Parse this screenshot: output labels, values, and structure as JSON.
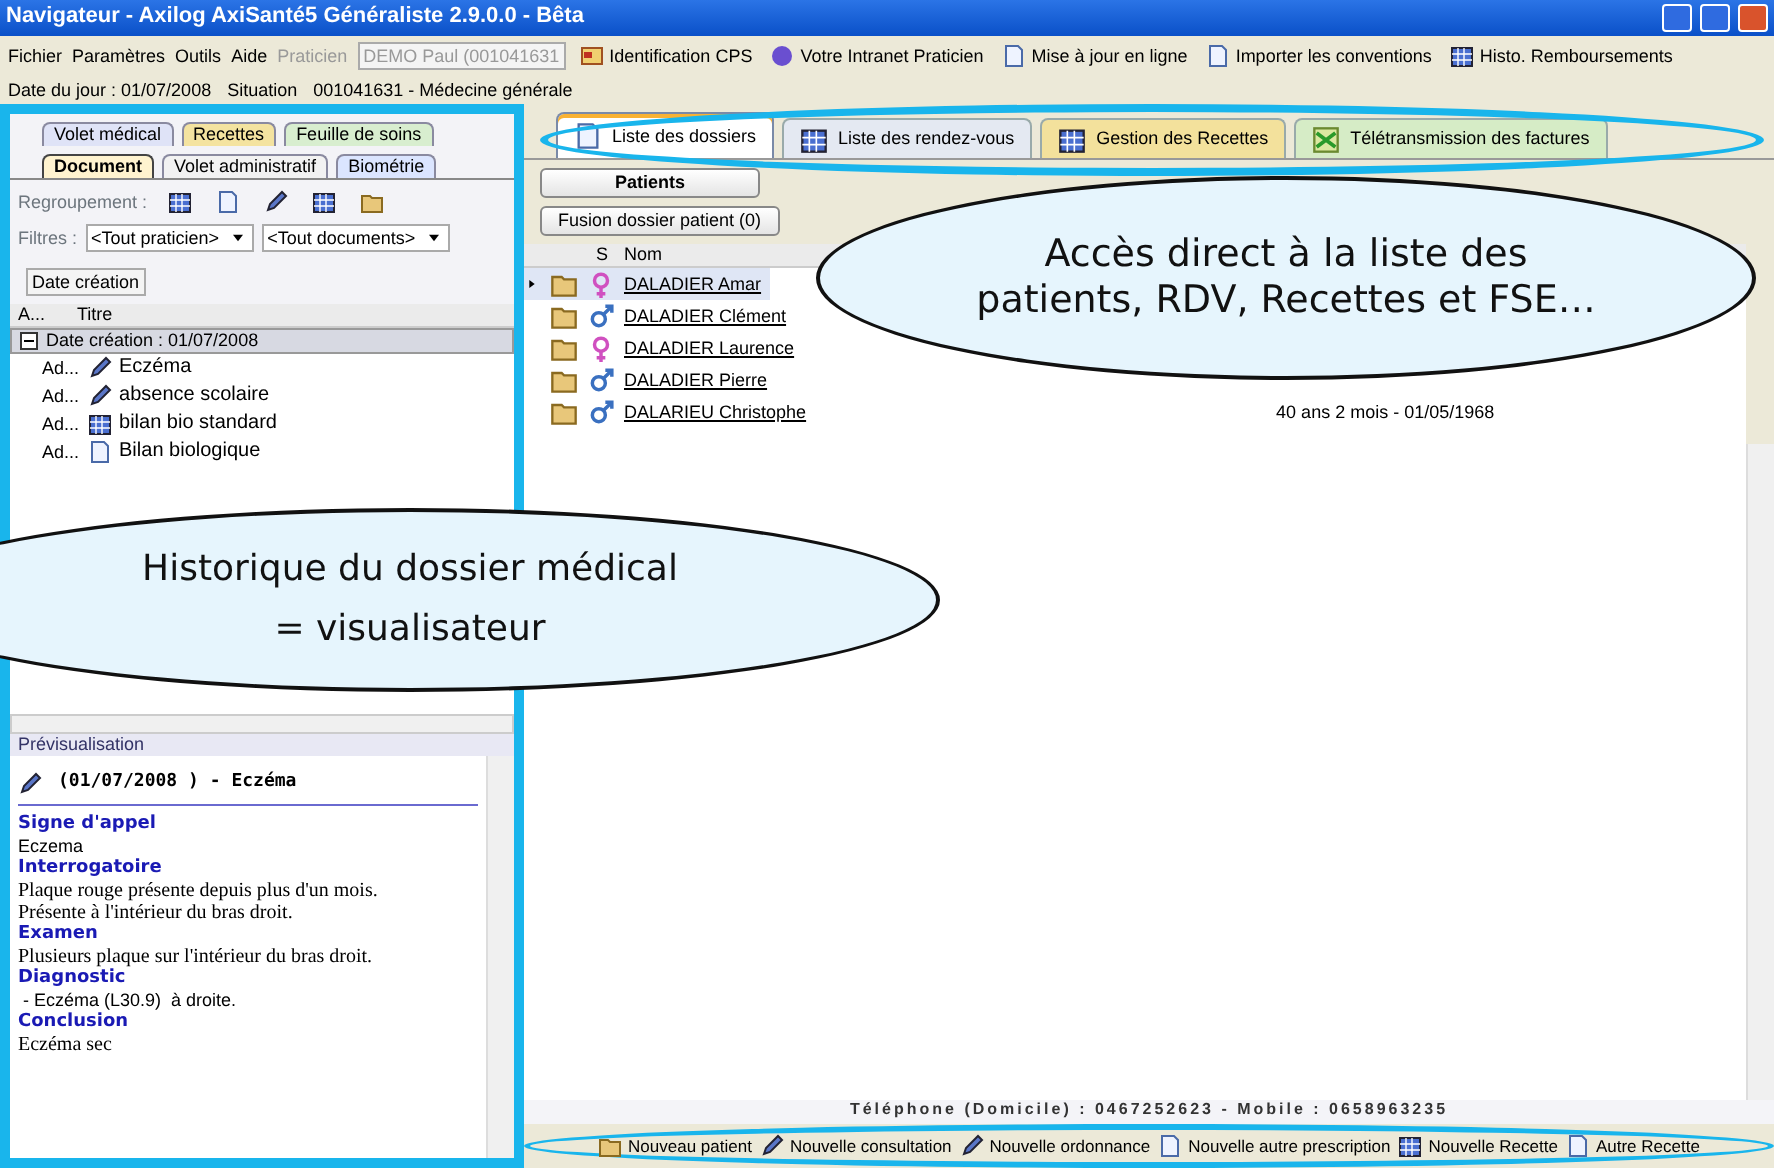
{
  "window": {
    "title": "Navigateur - Axilog AxiSanté5 Généraliste 2.9.0.0  - Bêta"
  },
  "menu": [
    "Fichier",
    "Paramètres",
    "Outils",
    "Aide"
  ],
  "praticien": {
    "label": "Praticien",
    "value": "DEMO Paul (001041631",
    "disabled": true
  },
  "toolbar": [
    "Identification CPS",
    "Votre Intranet Praticien",
    "Mise à jour en ligne",
    "Importer les conventions",
    "Histo. Remboursements"
  ],
  "info": {
    "date": "Date du jour : 01/07/2008",
    "situation_label": "Situation",
    "situation_value": "001041631 - Médecine générale"
  },
  "left_panel": {
    "tabs_row1": [
      {
        "label": "Volet médical",
        "selected": false,
        "color": "#dfe3f7"
      },
      {
        "label": "Recettes",
        "selected": false,
        "color": "#f4e3a0"
      },
      {
        "label": "Feuille de soins",
        "selected": false,
        "color": "#d8eecf"
      }
    ],
    "tabs_row2": [
      {
        "label": "Document",
        "selected": true,
        "color": "#fff3cf"
      },
      {
        "label": "Volet administratif",
        "selected": false,
        "color": "#f2f2f2"
      },
      {
        "label": "Biométrie",
        "selected": false,
        "color": "#dbe5ff"
      }
    ],
    "regroupement_label": "Regroupement :",
    "filters_label": "Filtres :",
    "filters": [
      "<Tout praticien>",
      "<Tout documents>"
    ],
    "group_by": "Date création",
    "columns": [
      "A...",
      "Titre"
    ],
    "group": {
      "label": "Date création : 01/07/2008",
      "expanded": true,
      "items": [
        {
          "author": "Ad...",
          "title": "Eczéma"
        },
        {
          "author": "Ad...",
          "title": "absence scolaire"
        },
        {
          "author": "Ad...",
          "title": "bilan bio standard"
        },
        {
          "author": "Ad...",
          "title": "Bilan biologique"
        }
      ]
    },
    "preview": {
      "label": "Prévisualisation",
      "heading": "(01/07/2008 ) - Eczéma",
      "sections": [
        {
          "heading": "Signe d'appel",
          "lines": [
            "Eczema"
          ],
          "kind": "sans"
        },
        {
          "heading": "Interrogatoire",
          "lines": [
            "Plaque rouge présente depuis plus d'un mois.",
            "Présente à l'intérieur du bras droit."
          ],
          "kind": "serif"
        },
        {
          "heading": "Examen",
          "lines": [
            "Plusieurs plaque sur l'intérieur du bras droit."
          ],
          "kind": "serif"
        },
        {
          "heading": "Diagnostic",
          "lines": [
            " - Eczéma (L30.9)  à droite."
          ],
          "kind": "sans"
        },
        {
          "heading": "Conclusion",
          "lines": [
            "Eczéma sec"
          ],
          "kind": "serif"
        }
      ]
    }
  },
  "right_panel": {
    "tabs": [
      {
        "label": "Liste des dossiers",
        "selected": true,
        "color": "#ffffff"
      },
      {
        "label": "Liste des rendez-vous",
        "selected": false,
        "color": "#e4e9f2"
      },
      {
        "label": "Gestion des Recettes",
        "selected": false,
        "color": "#f3e19c"
      },
      {
        "label": "Télétransmission des factures",
        "selected": false,
        "color": "#d6ecc6"
      }
    ],
    "patients_button": "Patients",
    "fusion_button": "Fusion dossier patient (0)",
    "columns": [
      "S",
      "Nom"
    ],
    "rows": [
      {
        "name": "DALADIER Amar",
        "kind": "female",
        "selected": true
      },
      {
        "name": "DALADIER Clément",
        "kind": "male",
        "selected": false
      },
      {
        "name": "DALADIER Laurence",
        "kind": "female",
        "selected": false
      },
      {
        "name": "DALADIER Pierre",
        "kind": "male",
        "selected": false
      },
      {
        "name": "DALARIEU Christophe",
        "kind": "male",
        "selected": false,
        "age": "40 ans 2 mois  - 01/05/1968"
      }
    ],
    "phone": "Téléphone (Domicile) : 0467252623 - Mobile : 0658963235",
    "actions": [
      "Nouveau patient",
      "Nouvelle consultation",
      "Nouvelle ordonnance",
      "Nouvelle autre prescription",
      "Nouvelle Recette",
      "Autre Recette"
    ]
  },
  "callouts": [
    {
      "lines": [
        "Accès direct à la liste des",
        "patients, RDV, Recettes et FSE…"
      ]
    },
    {
      "lines": [
        "Historique du dossier médical",
        "= visualisateur"
      ]
    }
  ]
}
